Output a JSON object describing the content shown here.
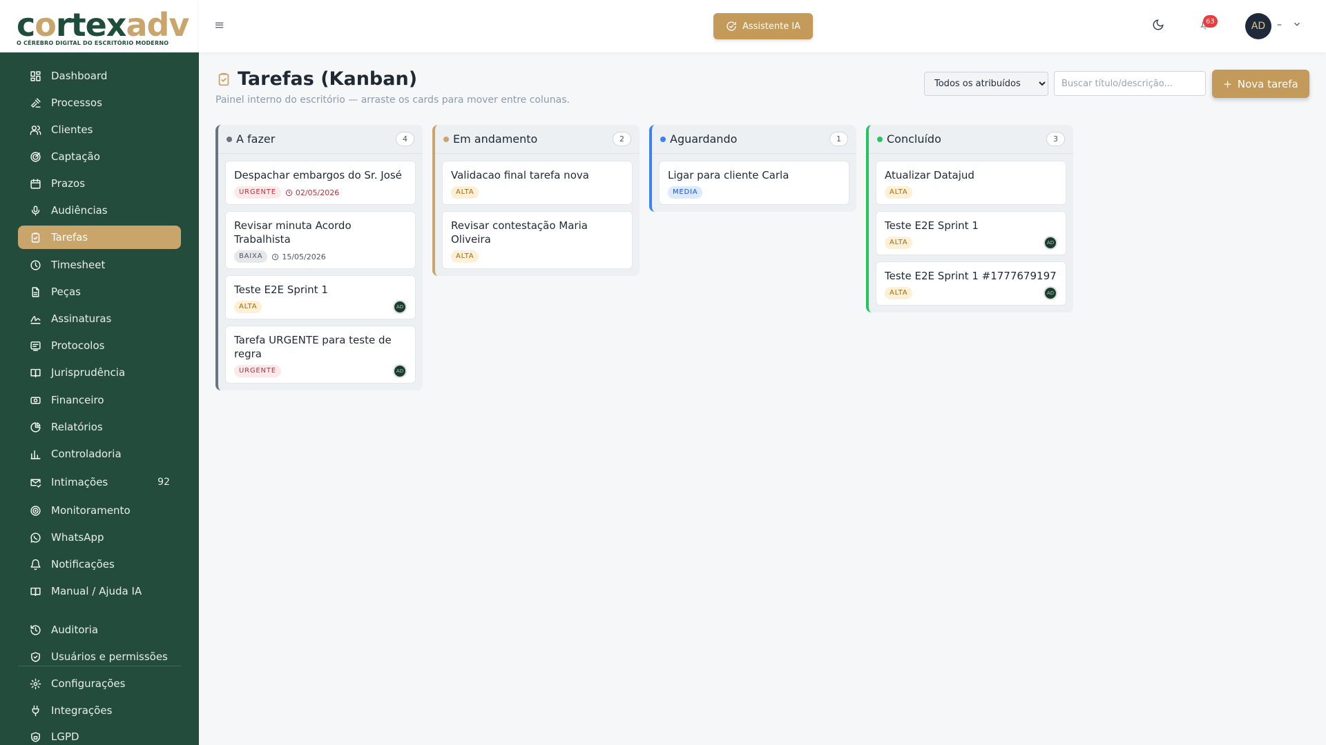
{
  "brand": {
    "logo_part1": "c",
    "logo_part2": "rtex",
    "logo_part3": "adv",
    "tagline": "O CÉREBRO DIGITAL DO ESCRITÓRIO MODERNO"
  },
  "sidebar": {
    "items": [
      {
        "label": "Dashboard",
        "icon": "dashboard-icon"
      },
      {
        "label": "Processos",
        "icon": "gavel-icon"
      },
      {
        "label": "Clientes",
        "icon": "users-icon"
      },
      {
        "label": "Captação",
        "icon": "target-icon"
      },
      {
        "label": "Prazos",
        "icon": "calendar-icon"
      },
      {
        "label": "Audiências",
        "icon": "mic-icon"
      },
      {
        "label": "Tarefas",
        "icon": "clipboard-check-icon",
        "active": true
      },
      {
        "label": "Timesheet",
        "icon": "clock-icon"
      },
      {
        "label": "Peças",
        "icon": "document-icon"
      },
      {
        "label": "Assinaturas",
        "icon": "signature-icon"
      },
      {
        "label": "Protocolos",
        "icon": "protocol-icon"
      },
      {
        "label": "Jurisprudência",
        "icon": "book-icon"
      },
      {
        "label": "Financeiro",
        "icon": "money-icon"
      },
      {
        "label": "Relatórios",
        "icon": "pie-chart-icon"
      },
      {
        "label": "Controladoria",
        "icon": "bar-chart-icon"
      },
      {
        "label": "Intimações",
        "icon": "mail-check-icon",
        "count": "92"
      },
      {
        "label": "Monitoramento",
        "icon": "radar-icon"
      },
      {
        "label": "WhatsApp",
        "icon": "whatsapp-icon"
      },
      {
        "label": "Notificações",
        "icon": "bell-icon"
      },
      {
        "label": "Manual / Ajuda IA",
        "icon": "book-open-icon"
      },
      {
        "label": "Auditoria",
        "icon": "history-icon"
      },
      {
        "label": "Usuários e permissões",
        "icon": "shield-icon"
      },
      {
        "label": "Configurações",
        "icon": "gear-icon"
      },
      {
        "label": "Integrações",
        "icon": "plug-icon"
      },
      {
        "label": "LGPD",
        "icon": "lock-shield-icon"
      }
    ]
  },
  "topbar": {
    "menu_icon": "≡",
    "assistant_label": "Assistente IA",
    "notification_count": "63",
    "avatar_initials": "AD",
    "user_name": "–"
  },
  "page": {
    "title": "Tarefas (Kanban)",
    "subtitle": "Painel interno do escritório — arraste os cards para mover entre colunas.",
    "filter_selected": "Todos os atribuídos",
    "search_placeholder": "Buscar título/descrição...",
    "new_task_label": "Nova tarefa",
    "new_task_plus": "+"
  },
  "columns": [
    {
      "title": "A fazer",
      "count": "4",
      "color": "#6b7280",
      "cards": [
        {
          "title": "Despachar embargos do Sr. José",
          "tag": "URGENTE",
          "tag_type": "urgent",
          "due": "02/05/2026",
          "due_type": "red"
        },
        {
          "title": "Revisar minuta Acordo Trabalhista",
          "tag": "BAIXA",
          "tag_type": "baixa",
          "due": "15/05/2026",
          "due_type": "gray"
        },
        {
          "title": "Teste E2E Sprint 1",
          "tag": "ALTA",
          "tag_type": "alta",
          "avatar": "AD"
        },
        {
          "title": "Tarefa URGENTE para teste de regra",
          "tag": "URGENTE",
          "tag_type": "urgent",
          "avatar": "AD"
        }
      ]
    },
    {
      "title": "Em andamento",
      "count": "2",
      "color": "#c9a56b",
      "cards": [
        {
          "title": "Validacao final tarefa nova",
          "tag": "ALTA",
          "tag_type": "alta"
        },
        {
          "title": "Revisar contestação Maria Oliveira",
          "tag": "ALTA",
          "tag_type": "alta"
        }
      ]
    },
    {
      "title": "Aguardando",
      "count": "1",
      "color": "#3b82f6",
      "cards": [
        {
          "title": "Ligar para cliente Carla",
          "tag": "MEDIA",
          "tag_type": "media"
        }
      ]
    },
    {
      "title": "Concluído",
      "count": "3",
      "color": "#22c55e",
      "cards": [
        {
          "title": "Atualizar Datajud",
          "tag": "ALTA",
          "tag_type": "alta"
        },
        {
          "title": "Teste E2E Sprint 1",
          "tag": "ALTA",
          "tag_type": "alta",
          "avatar": "AD"
        },
        {
          "title": "Teste E2E Sprint 1 #1777679197",
          "tag": "ALTA",
          "tag_type": "alta",
          "avatar": "AD"
        }
      ]
    }
  ]
}
